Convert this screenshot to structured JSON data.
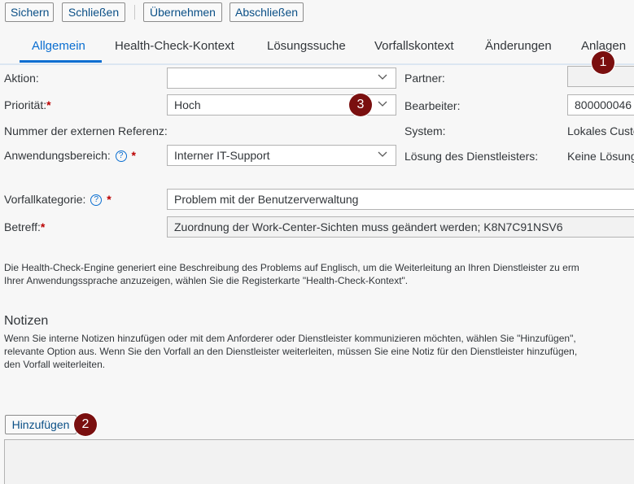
{
  "toolbar": {
    "save_label": "Sichern",
    "close_label": "Schließen",
    "apply_label": "Übernehmen",
    "complete_label": "Abschließen"
  },
  "tabs": [
    {
      "label": "Allgemein",
      "active": true
    },
    {
      "label": "Health-Check-Kontext"
    },
    {
      "label": "Lösungssuche"
    },
    {
      "label": "Vorfallskontext"
    },
    {
      "label": "Änderungen"
    },
    {
      "label": "Anlagen"
    }
  ],
  "form": {
    "action_label": "Aktion:",
    "action_value": "",
    "priority_label": "Priorität:",
    "priority_value": "Hoch",
    "external_ref_label": "Nummer der externen Referenz:",
    "app_area_label": "Anwendungsbereich:",
    "app_area_value": "Interner IT-Support",
    "incident_category_label": "Vorfallkategorie:",
    "incident_category_value": "Problem mit der Benutzerverwaltung",
    "subject_label": "Betreff:",
    "subject_value": "Zuordnung der Work-Center-Sichten muss geändert werden; K8N7C91NSV6",
    "required_marker": "*",
    "help_glyph": "?",
    "partner_label": "Partner:",
    "partner_value": "",
    "processor_label": "Bearbeiter:",
    "processor_value": "800000046",
    "system_label": "System:",
    "system_value": "Lokales Custo",
    "provider_solution_label": "Lösung des Dienstleisters:",
    "provider_solution_value": "Keine Lösung"
  },
  "info": {
    "line1": "Die Health-Check-Engine generiert eine Beschreibung des Problems auf Englisch, um die Weiterleitung an Ihren Dienstleister zu erm",
    "line2": "Ihrer Anwendungssprache anzuzeigen, wählen Sie die Registerkarte \"Health-Check-Kontext\"."
  },
  "notes": {
    "title": "Notizen",
    "line1": "Wenn Sie interne Notizen hinzufügen oder mit dem Anforderer oder Dienstleister kommunizieren möchten, wählen Sie \"Hinzufügen\",",
    "line2": "relevante Option aus. Wenn Sie den Vorfall an den Dienstleister weiterleiten, müssen Sie eine Notiz für den Dienstleister hinzufügen,",
    "line3": "den Vorfall weiterleiten.",
    "add_label": "Hinzufügen"
  },
  "badges": [
    "1",
    "2",
    "3"
  ],
  "colors": {
    "accent": "#0a6ed1",
    "required": "#bb0000",
    "badge": "#7a0f0f"
  }
}
